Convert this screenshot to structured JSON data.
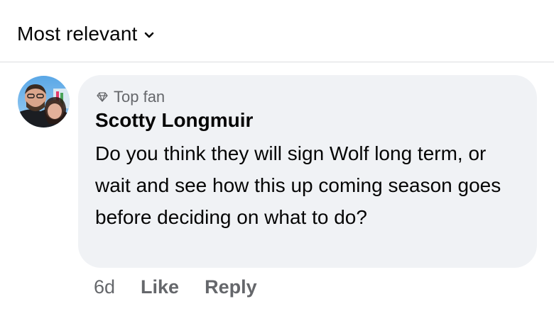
{
  "sort": {
    "label": "Most relevant",
    "icon": "chevron-down-icon"
  },
  "comment": {
    "badge": "Top fan",
    "badge_icon": "diamond-icon",
    "author": "Scotty Longmuir",
    "text": "Do you think they will sign Wolf long term, or wait and see how this up coming season goes before deciding on what to do?",
    "timestamp": "6d",
    "like_label": "Like",
    "reply_label": "Reply"
  },
  "colors": {
    "bubble": "#f0f2f5",
    "secondary_text": "#65676b",
    "primary_text": "#050505"
  }
}
